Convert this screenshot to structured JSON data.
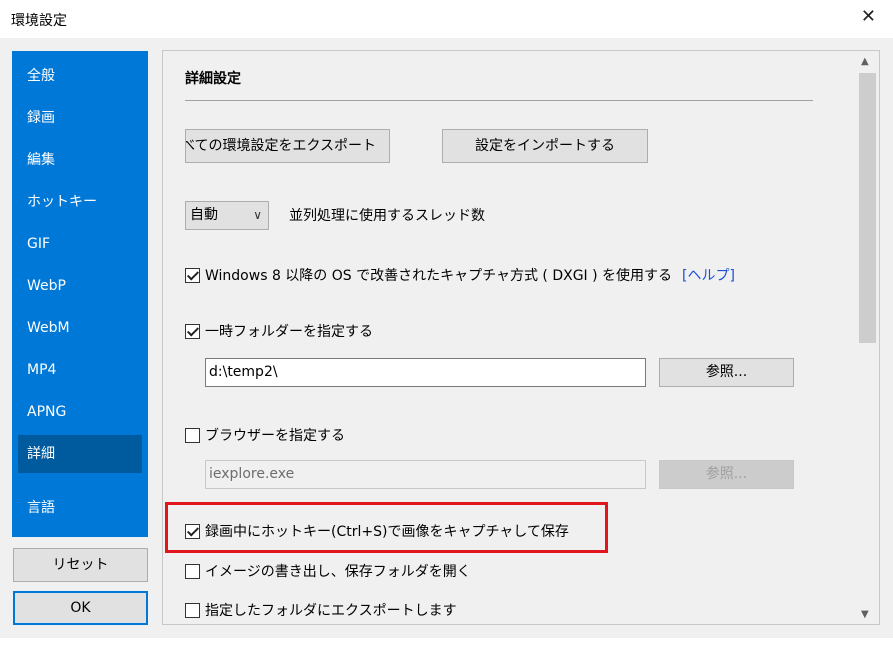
{
  "window": {
    "title": "環境設定",
    "close_glyph": "✕"
  },
  "sidebar": {
    "items": [
      {
        "label": "全般"
      },
      {
        "label": "録画"
      },
      {
        "label": "編集"
      },
      {
        "label": "ホットキー"
      },
      {
        "label": "GIF"
      },
      {
        "label": "WebP"
      },
      {
        "label": "WebM"
      },
      {
        "label": "MP4"
      },
      {
        "label": "APNG"
      },
      {
        "label": "詳細",
        "active": true
      },
      {
        "label": "言語"
      }
    ],
    "reset_label": "リセット",
    "ok_label": "OK"
  },
  "main": {
    "section_title": "詳細設定",
    "export_label": "すべての環境設定をエクスポート",
    "import_label": "設定をインポートする",
    "thread_select_value": "自動",
    "thread_label": "並列処理に使用するスレッド数",
    "dxgi_label": "Windows 8 以降の OS で改善されたキャプチャ方式 ( DXGI ) を使用する",
    "dxgi_checked": true,
    "help_link": "[ヘルプ]",
    "temp_folder_label": "一時フォルダーを指定する",
    "temp_folder_checked": true,
    "temp_folder_value": "d:\\temp2\\",
    "browse_label": "参照...",
    "browser_label": "ブラウザーを指定する",
    "browser_checked": false,
    "browser_value": "iexplore.exe",
    "browse_label_disabled": "参照...",
    "hotkey_capture_label": "録画中にホットキー(Ctrl+S)で画像をキャプチャして保存",
    "hotkey_capture_checked": true,
    "open_folder_label": "イメージの書き出し、保存フォルダを開く",
    "open_folder_checked": false,
    "export_folder_label": "指定したフォルダにエクスポートします",
    "export_folder_checked": false
  },
  "colors": {
    "accent": "#0078d7",
    "active_nav": "#005a9e",
    "highlight": "#e0151d",
    "link": "#1a4fd8"
  }
}
